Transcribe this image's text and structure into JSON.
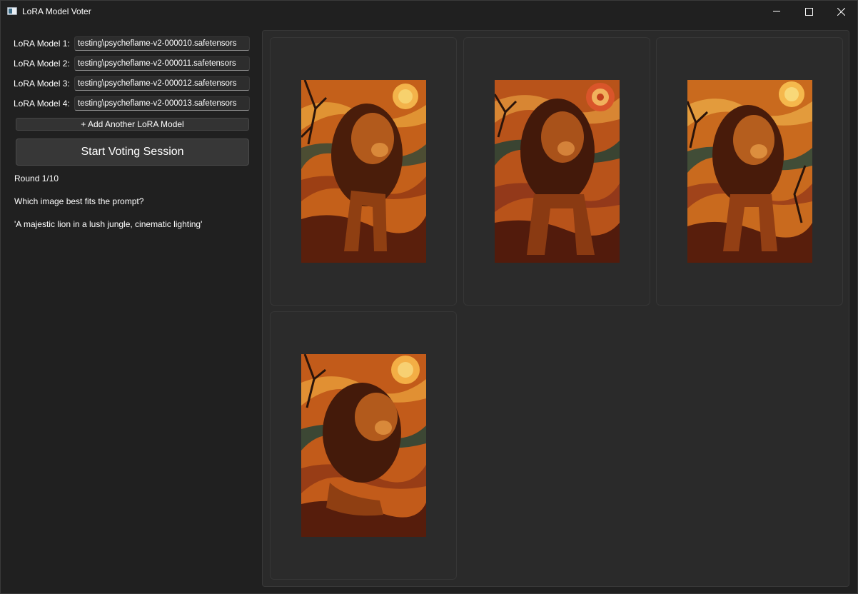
{
  "window": {
    "title": "LoRA Model Voter",
    "controls": [
      "minimize-icon",
      "maximize-icon",
      "close-icon"
    ]
  },
  "lora_models": [
    {
      "label": "LoRA Model 1:",
      "value": "testing\\psycheflame-v2-000010.safetensors"
    },
    {
      "label": "LoRA Model 2:",
      "value": "testing\\psycheflame-v2-000011.safetensors"
    },
    {
      "label": "LoRA Model 3:",
      "value": "testing\\psycheflame-v2-000012.safetensors"
    },
    {
      "label": "LoRA Model 4:",
      "value": "testing\\psycheflame-v2-000013.safetensors"
    }
  ],
  "add_button_label": "+ Add Another LoRA Model",
  "start_button_label": "Start Voting Session",
  "round": "Round 1/10",
  "question": "Which image best fits the prompt?",
  "prompt": "'A majestic lion in a lush jungle, cinematic lighting'",
  "colors": {
    "background": "#202020",
    "panel": "#2a2a2a",
    "card": "#2b2b2b",
    "sun": "#f2a23a",
    "lion": "#8a3d12"
  }
}
